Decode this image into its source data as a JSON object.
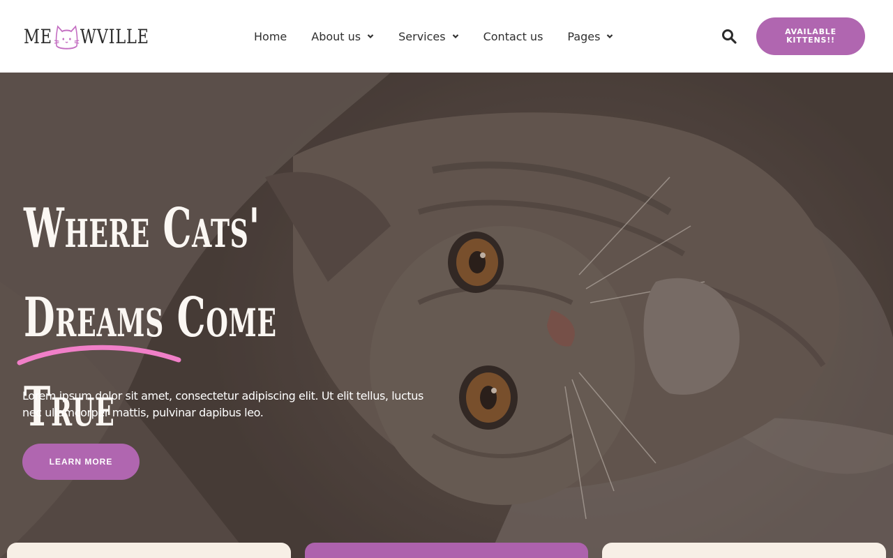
{
  "logo": {
    "text_left": "ME",
    "text_right": "WVILLE"
  },
  "nav": {
    "items": [
      {
        "label": "Home",
        "has_dropdown": false
      },
      {
        "label": "About us",
        "has_dropdown": true
      },
      {
        "label": "Services",
        "has_dropdown": true
      },
      {
        "label": "Contact us",
        "has_dropdown": false
      },
      {
        "label": "Pages",
        "has_dropdown": true
      }
    ]
  },
  "header": {
    "cta_label": "AVAILABLE KITTENS!!",
    "search_icon": "search-icon"
  },
  "hero": {
    "title_line1": "Where Cats'",
    "title_line2": "Dreams Come True",
    "description": "Lorem ipsum dolor sit amet, consectetur adipiscing elit. Ut elit tellus, luctus nec ullamcorper mattis, pulvinar dapibus leo.",
    "cta_label": "LEARN MORE"
  },
  "colors": {
    "accent": "#b066b0",
    "underline": "#f07fc8",
    "card_light": "#f7efe6"
  }
}
